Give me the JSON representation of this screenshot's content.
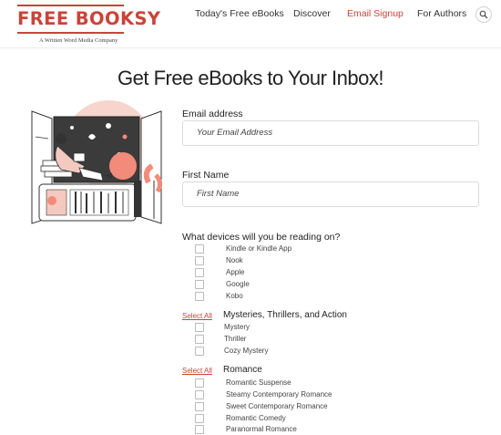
{
  "header": {
    "logo_text": "FREE BOOKSY",
    "logo_tagline": "A Written Word Media Company",
    "nav": [
      {
        "label": "Today's Free eBooks",
        "active": false
      },
      {
        "label": "Discover",
        "active": false
      },
      {
        "label": "Email Signup",
        "active": true
      },
      {
        "label": "For Authors",
        "active": false
      }
    ],
    "search_icon": "search-icon"
  },
  "page_title": "Get Free eBooks to Your Inbox!",
  "form": {
    "email": {
      "label": "Email address",
      "placeholder": "Your Email Address",
      "value": ""
    },
    "first_name": {
      "label": "First Name",
      "placeholder": "First Name",
      "value": ""
    },
    "devices": {
      "label": "What devices will you be reading on?",
      "options": [
        "Kindle or Kindle App",
        "Nook",
        "Apple",
        "Google",
        "Kobo"
      ]
    },
    "genres": [
      {
        "select_all": "Select All",
        "title": "Mysteries, Thrillers, and Action",
        "options": [
          "Mystery",
          "Thriller",
          "Cozy Mystery"
        ]
      },
      {
        "select_all": "Select All",
        "title": "Romance",
        "options": [
          "Romantic Suspense",
          "Steamy Contemporary Romance",
          "Sweet Contemporary Romance",
          "Romantic Comedy",
          "Paranormal Romance"
        ]
      }
    ]
  },
  "colors": {
    "accent": "#c9443a",
    "border": "#dcdcdc",
    "illustration_pink": "#f4c9c0"
  }
}
